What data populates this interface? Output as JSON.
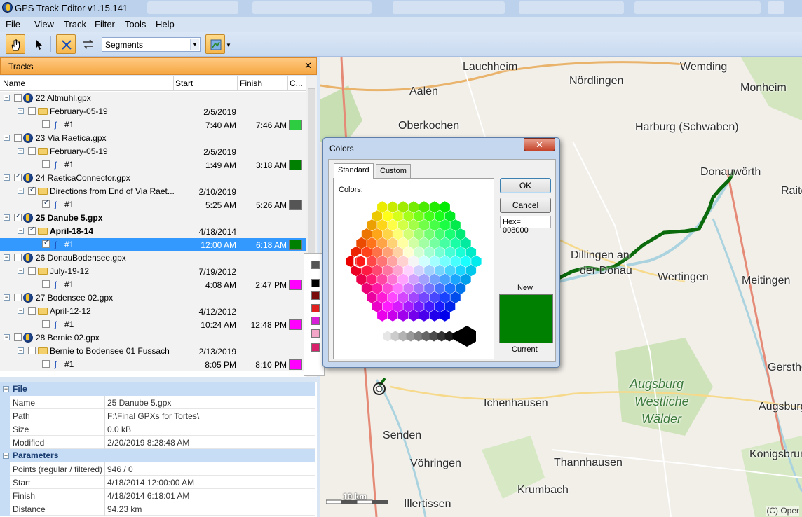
{
  "window": {
    "title": "GPS Track Editor v1.15.141"
  },
  "menu": [
    "File",
    "View",
    "Track",
    "Filter",
    "Tools",
    "Help"
  ],
  "toolbar": {
    "mode_select": "Segments"
  },
  "tracks_panel": {
    "title": "Tracks",
    "columns": {
      "name": "Name",
      "start": "Start",
      "finish": "Finish",
      "color": "C..."
    },
    "rows": [
      {
        "level": 0,
        "name": "22 Altmuhl.gpx",
        "checked": false,
        "bold": false,
        "start": "",
        "finish": "",
        "color": ""
      },
      {
        "level": 1,
        "name": "February-05-19",
        "checked": false,
        "bold": false,
        "start": "2/5/2019",
        "finish": "",
        "color": ""
      },
      {
        "level": 2,
        "name": "#1",
        "checked": false,
        "bold": false,
        "start": "7:40 AM",
        "finish": "7:46 AM",
        "color": "#2ecc40"
      },
      {
        "level": 0,
        "name": "23 Via Raetica.gpx",
        "checked": false,
        "bold": false,
        "start": "",
        "finish": "",
        "color": ""
      },
      {
        "level": 1,
        "name": "February-05-19",
        "checked": false,
        "bold": false,
        "start": "2/5/2019",
        "finish": "",
        "color": ""
      },
      {
        "level": 2,
        "name": "#1",
        "checked": false,
        "bold": false,
        "start": "1:49 AM",
        "finish": "3:18 AM",
        "color": "#008000"
      },
      {
        "level": 0,
        "name": "24 RaeticaConnector.gpx",
        "checked": true,
        "bold": false,
        "start": "",
        "finish": "",
        "color": ""
      },
      {
        "level": 1,
        "name": "Directions from End of Via Raet...",
        "checked": true,
        "bold": false,
        "start": "2/10/2019",
        "finish": "",
        "color": ""
      },
      {
        "level": 2,
        "name": "#1",
        "checked": true,
        "bold": false,
        "start": "5:25 AM",
        "finish": "5:26 AM",
        "color": "#555555"
      },
      {
        "level": 0,
        "name": "25 Danube 5.gpx",
        "checked": true,
        "bold": true,
        "start": "",
        "finish": "",
        "color": ""
      },
      {
        "level": 1,
        "name": "April-18-14",
        "checked": true,
        "bold": true,
        "start": "4/18/2014",
        "finish": "",
        "color": ""
      },
      {
        "level": 2,
        "name": "#1",
        "checked": true,
        "bold": false,
        "start": "12:00 AM",
        "finish": "6:18 AM",
        "color": "#008000",
        "selected": true
      },
      {
        "level": 0,
        "name": "26 DonauBodensee.gpx",
        "checked": false,
        "bold": false,
        "start": "",
        "finish": "",
        "color": ""
      },
      {
        "level": 1,
        "name": "July-19-12",
        "checked": false,
        "bold": false,
        "start": "7/19/2012",
        "finish": "",
        "color": ""
      },
      {
        "level": 2,
        "name": "#1",
        "checked": false,
        "bold": false,
        "start": "4:08 AM",
        "finish": "2:47 PM",
        "color": "#ff00ff"
      },
      {
        "level": 0,
        "name": "27 Bodensee 02.gpx",
        "checked": false,
        "bold": false,
        "start": "",
        "finish": "",
        "color": ""
      },
      {
        "level": 1,
        "name": "April-12-12",
        "checked": false,
        "bold": false,
        "start": "4/12/2012",
        "finish": "",
        "color": ""
      },
      {
        "level": 2,
        "name": "#1",
        "checked": false,
        "bold": false,
        "start": "10:24 AM",
        "finish": "12:48 PM",
        "color": "#ff00ff"
      },
      {
        "level": 0,
        "name": "28 Bernie 02.gpx",
        "checked": false,
        "bold": false,
        "start": "",
        "finish": "",
        "color": ""
      },
      {
        "level": 1,
        "name": "Bernie to Bodensee 01 Fussach",
        "checked": false,
        "bold": false,
        "start": "2/13/2019",
        "finish": "",
        "color": ""
      },
      {
        "level": 2,
        "name": "#1",
        "checked": false,
        "bold": false,
        "start": "8:05 PM",
        "finish": "8:10 PM",
        "color": "#ff00ff"
      }
    ]
  },
  "properties": {
    "file": {
      "label": "File",
      "rows": [
        {
          "k": "Name",
          "v": "25 Danube 5.gpx"
        },
        {
          "k": "Path",
          "v": "F:\\Final GPXs for Tortes\\"
        },
        {
          "k": "Size",
          "v": "0.0 kB"
        },
        {
          "k": "Modified",
          "v": "2/20/2019 8:28:48 AM"
        }
      ]
    },
    "parameters": {
      "label": "Parameters",
      "rows": [
        {
          "k": "Points (regular / filtered)",
          "v": "946 / 0"
        },
        {
          "k": "Start",
          "v": "4/18/2014 12:00:00 AM"
        },
        {
          "k": "Finish",
          "v": "4/18/2014 6:18:01 AM"
        },
        {
          "k": "Distance",
          "v": "94.23 km"
        }
      ]
    }
  },
  "colors_dialog": {
    "title": "Colors",
    "tabs": {
      "standard": "Standard",
      "custom": "Custom"
    },
    "colors_label": "Colors:",
    "ok": "OK",
    "cancel": "Cancel",
    "hex": "Hex= 008000",
    "new_label": "New",
    "current_label": "Current",
    "new_color": "#008000"
  },
  "map": {
    "towns": [
      "Lauchheim",
      "Nördlingen",
      "Wemding",
      "Monheim",
      "Aalen",
      "Oberkochen",
      "Harburg (Schwaben)",
      "Donauwörth",
      "Raitenbuch",
      "Dillingen an",
      "der Donau",
      "Wertingen",
      "Meitingen",
      "Gersthofen",
      "Augsburg",
      "Westliche",
      "Wälder",
      "Ichenhausen",
      "Augsburg",
      "Senden",
      "Thannhausen",
      "Königsbrunn",
      "Vöhringen",
      "Krumbach",
      "Illertissen"
    ],
    "scale": "10 km",
    "copyright": "(C) Oper"
  }
}
